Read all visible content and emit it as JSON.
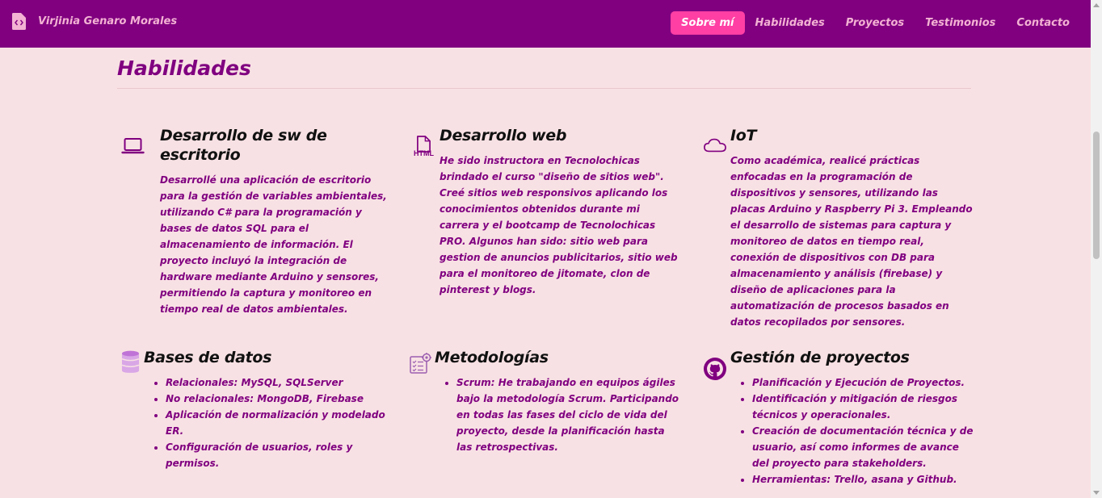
{
  "header": {
    "brand": "Virjinia Genaro Morales",
    "nav": [
      "Sobre mí",
      "Habilidades",
      "Proyectos",
      "Testimonios",
      "Contacto"
    ]
  },
  "section": {
    "title": "Habilidades"
  },
  "cards": [
    {
      "title": "Desarrollo de sw de escritorio",
      "icon": "laptop-icon",
      "text": "Desarrollé una aplicación de escritorio para la gestión de variables ambientales, utilizando C# para la programación y bases de datos SQL para el almacenamiento de información. El proyecto incluyó la integración de hardware mediante Arduino y sensores, permitiendo la captura y monitoreo en tiempo real de datos ambientales."
    },
    {
      "title": "Desarrollo web",
      "icon": "html-file-icon",
      "icon_label": "HTML",
      "text": "He sido instructora en Tecnolochicas brindado el curso \"diseño de sitios web\". Creé sitios web responsivos aplicando los conocimientos obtenidos durante mi carrera y el bootcamp de Tecnolochicas PRO. Algunos han sido: sitio web para gestion de anuncios publicitarios, sitio web para el monitoreo de jitomate, clon de pinterest y blogs."
    },
    {
      "title": "IoT",
      "icon": "cloud-icon",
      "text": "Como académica, realicé prácticas enfocadas en la programación de dispositivos y sensores, utilizando las placas Arduino y Raspberry Pi 3. Empleando el desarrollo de sistemas para captura y monitoreo de datos en tiempo real, conexión de dispositivos con DB para almacenamiento y análisis (firebase) y diseño de aplicaciones para la automatización de procesos basados en datos recopilados por sensores."
    },
    {
      "title": "Bases de datos",
      "icon": "database-icon",
      "items": [
        "Relacionales: MySQL, SQLServer",
        "No relacionales: MongoDB, Firebase",
        "Aplicación de normalización y modelado ER.",
        "Configuración de usuarios, roles y permisos."
      ]
    },
    {
      "title": "Metodologías",
      "icon": "methodology-icon",
      "items": [
        "Scrum: He trabajando en equipos ágiles bajo la metodología Scrum. Participando en todas las fases del ciclo de vida del proyecto, desde la planificación hasta las retrospectivas."
      ]
    },
    {
      "title": "Gestión de proyectos",
      "icon": "github-icon",
      "items": [
        "Planificación y Ejecución de Proyectos.",
        "Identificación y mitigación de riesgos técnicos y operacionales.",
        "Creación de documentación técnica y de usuario, así como informes de avance del proyecto para stakeholders.",
        "Herramientas: Trello, asana y Github."
      ]
    }
  ]
}
